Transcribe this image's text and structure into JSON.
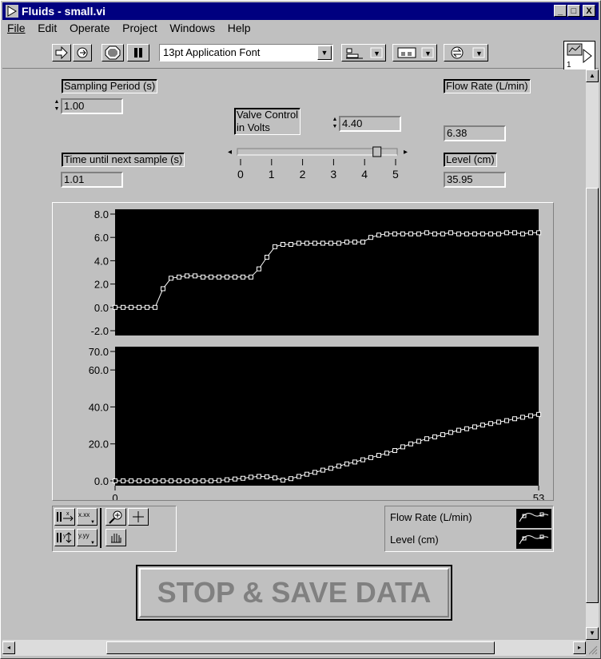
{
  "window": {
    "title": "Fluids - small.vi",
    "minimize": "_",
    "maximize": "□",
    "close": "X"
  },
  "menu": [
    "File",
    "Edit",
    "Operate",
    "Project",
    "Windows",
    "Help"
  ],
  "toolbar": {
    "font": "13pt Application Font",
    "context_number": "1"
  },
  "controls": {
    "sampling_period_label": "Sampling Period (s)",
    "sampling_period_value": "1.00",
    "time_until_label": "Time until next sample (s)",
    "time_until_value": "1.01",
    "valve_label": "Valve Control in Volts",
    "valve_label_line1": "Valve Control",
    "valve_label_line2": "in Volts",
    "valve_value": "4.40",
    "slider_ticks": [
      "0",
      "1",
      "2",
      "3",
      "4",
      "5"
    ],
    "slider_min": 0,
    "slider_max": 5,
    "slider_level": 4.4,
    "flow_rate_label": "Flow Rate (L/min)",
    "flow_rate_value": "6.38",
    "level_label": "Level (cm)",
    "level_value": "35.95"
  },
  "legend": {
    "series1": "Flow Rate (L/min)",
    "series2": "Level (cm)"
  },
  "stop_button": "STOP & SAVE DATA",
  "chart_data": [
    {
      "type": "line",
      "name_shown": "",
      "x": [
        0,
        1,
        2,
        3,
        4,
        5,
        6,
        7,
        8,
        9,
        10,
        11,
        12,
        13,
        14,
        15,
        16,
        17,
        18,
        19,
        20,
        21,
        22,
        23,
        24,
        25,
        26,
        27,
        28,
        29,
        30,
        31,
        32,
        33,
        34,
        35,
        36,
        37,
        38,
        39,
        40,
        41,
        42,
        43,
        44,
        45,
        46,
        47,
        48,
        49,
        50,
        51,
        52,
        53
      ],
      "series": [
        {
          "values": [
            0,
            0,
            0,
            0,
            0,
            0,
            1.6,
            2.5,
            2.6,
            2.7,
            2.7,
            2.6,
            2.6,
            2.6,
            2.6,
            2.6,
            2.6,
            2.6,
            3.3,
            4.3,
            5.2,
            5.4,
            5.4,
            5.5,
            5.5,
            5.5,
            5.5,
            5.5,
            5.5,
            5.6,
            5.6,
            5.6,
            6.0,
            6.2,
            6.3,
            6.3,
            6.3,
            6.3,
            6.3,
            6.4,
            6.3,
            6.3,
            6.4,
            6.3,
            6.3,
            6.3,
            6.3,
            6.3,
            6.3,
            6.4,
            6.4,
            6.3,
            6.4,
            6.4
          ]
        }
      ],
      "ylim": [
        -2,
        8
      ],
      "yticks": [
        "8.0",
        "6.0",
        "4.0",
        "2.0",
        "0.0",
        "-2.0"
      ],
      "grid": false
    },
    {
      "type": "line",
      "x": [
        0,
        1,
        2,
        3,
        4,
        5,
        6,
        7,
        8,
        9,
        10,
        11,
        12,
        13,
        14,
        15,
        16,
        17,
        18,
        19,
        20,
        21,
        22,
        23,
        24,
        25,
        26,
        27,
        28,
        29,
        30,
        31,
        32,
        33,
        34,
        35,
        36,
        37,
        38,
        39,
        40,
        41,
        42,
        43,
        44,
        45,
        46,
        47,
        48,
        49,
        50,
        51,
        52,
        53
      ],
      "series": [
        {
          "values": [
            0,
            0,
            0,
            0,
            0,
            0,
            0,
            0,
            0,
            0,
            0,
            0,
            0,
            0.2,
            0.6,
            1.0,
            1.4,
            2.0,
            2.4,
            2.2,
            1.6,
            0.4,
            1.2,
            2.4,
            3.6,
            4.6,
            5.8,
            6.8,
            8.0,
            9.2,
            10.2,
            11.4,
            12.6,
            13.8,
            15.0,
            16.4,
            18.4,
            20.0,
            21.4,
            22.8,
            23.8,
            25.0,
            26.2,
            27.4,
            28.2,
            29.2,
            30.2,
            31.0,
            31.8,
            32.6,
            33.6,
            34.4,
            35.2,
            35.95
          ]
        }
      ],
      "ylim": [
        0,
        70
      ],
      "yticks": [
        "70.0",
        "60.0",
        "40.0",
        "20.0",
        "0.0"
      ],
      "xticks": [
        "0",
        "53"
      ],
      "grid": false
    }
  ]
}
